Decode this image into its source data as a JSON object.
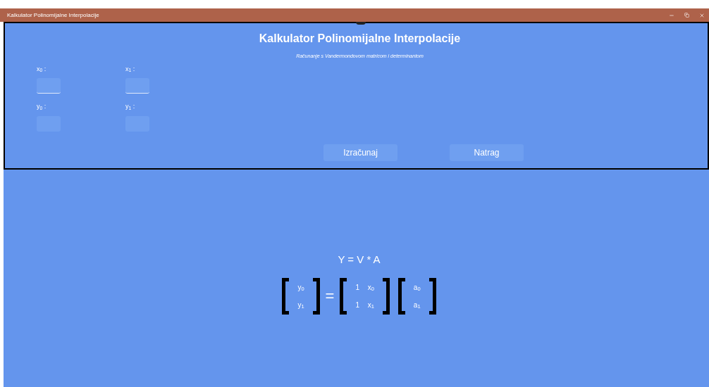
{
  "window": {
    "title": "Kalkulator Polinomijalne Interpolacije"
  },
  "header": {
    "title": "Kalkulator Polinomijalne Interpolacije",
    "subtitle": "Računanje s Vandermondovom matricom i determinantom"
  },
  "inputs": [
    {
      "label": "x$_{0}$ :",
      "underlined": true
    },
    {
      "label": "x$_{1}$ :",
      "underlined": true
    },
    {
      "label": "y$_{0}$ :",
      "underlined": false
    },
    {
      "label": "y$_{1}$ :",
      "underlined": false
    }
  ],
  "buttons": [
    "Izračunaj",
    "Natrag"
  ],
  "formula": {
    "equation": "Y = V * A",
    "y_vector": [
      "y$_{0}$",
      "y$_{1}$"
    ],
    "equals": "=",
    "v_matrix": [
      [
        "1",
        "x$_{0}$"
      ],
      [
        "1",
        "x$_{1}$"
      ]
    ],
    "a_vector": [
      "a$_{0}$",
      "a$_{1}$"
    ]
  }
}
